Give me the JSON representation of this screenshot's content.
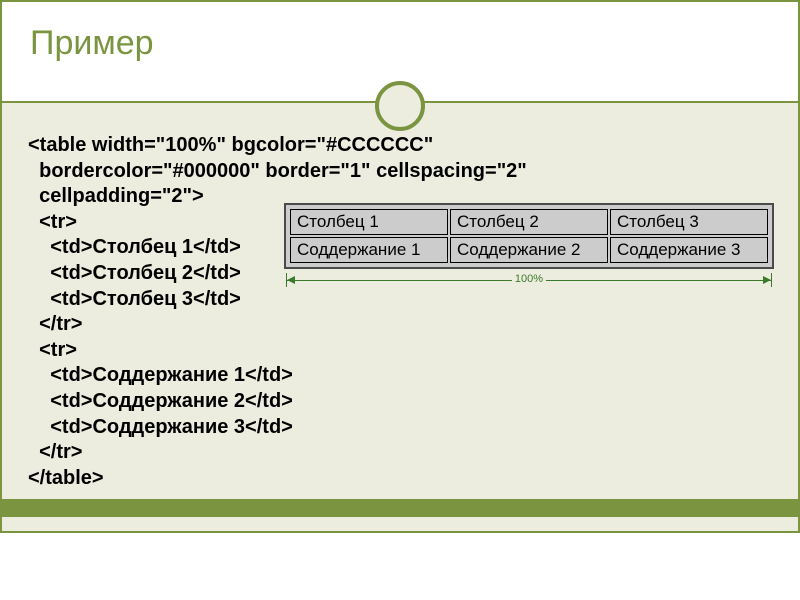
{
  "title": "Пример",
  "code": {
    "l1": "<table width=\"100%\" bgcolor=\"#CCCCCC\"",
    "l2": "  bordercolor=\"#000000\" border=\"1\" cellspacing=\"2\"",
    "l3": "  cellpadding=\"2\">",
    "l4": "  <tr>",
    "l5": "    <td>Столбец 1</td>",
    "l6": "    <td>Столбец 2</td>",
    "l7": "    <td>Столбец 3</td>",
    "l8": "  </tr>",
    "l9": "  <tr>",
    "l10": "    <td>Соддержание 1</td>",
    "l11": "    <td>Соддержание 2</td>",
    "l12": "    <td>Соддержание 3</td>",
    "l13": "  </tr>",
    "l14": "</table>"
  },
  "render": {
    "r1c1": "Столбец 1",
    "r1c2": "Столбец 2",
    "r1c3": "Столбец 3",
    "r2c1": "Соддержание 1",
    "r2c2": "Соддержание 2",
    "r2c3": "Соддержание 3",
    "width_label": "100%"
  }
}
